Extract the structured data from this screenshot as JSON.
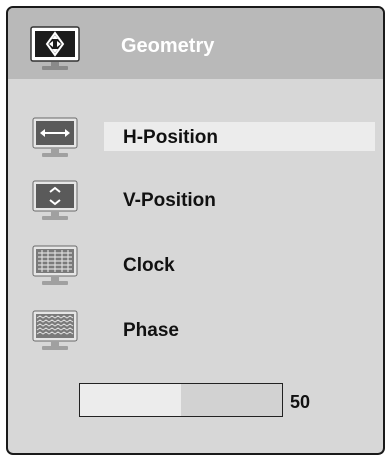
{
  "header": {
    "title": "Geometry",
    "icon": "geometry-monitor-icon"
  },
  "menu": {
    "items": [
      {
        "label": "H-Position",
        "icon": "h-position-icon",
        "selected": true
      },
      {
        "label": "V-Position",
        "icon": "v-position-icon",
        "selected": false
      },
      {
        "label": "Clock",
        "icon": "clock-icon",
        "selected": false
      },
      {
        "label": "Phase",
        "icon": "phase-icon",
        "selected": false
      }
    ]
  },
  "slider": {
    "value": "50",
    "level_fraction": 0.5
  },
  "colors": {
    "panel_bg": "#d7d7d7",
    "header_bg": "#b9b9b9",
    "highlight": "#ececec",
    "border": "#1a1a1a",
    "title_text": "#ffffff"
  }
}
